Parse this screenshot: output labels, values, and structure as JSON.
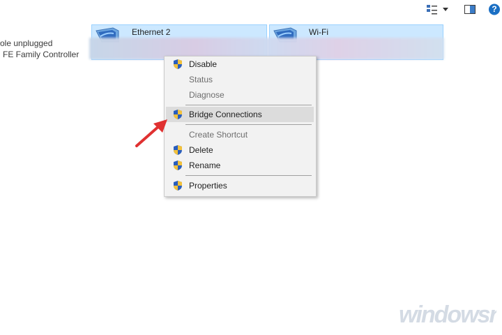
{
  "toolbar": {
    "view_icon": "view-options-icon",
    "dropdown_icon": "chevron-down-icon",
    "preview_pane_icon": "preview-pane-icon",
    "help_icon": "help-icon",
    "help_glyph": "?"
  },
  "left_adapter": {
    "status_line": "ole unplugged",
    "device_line": "FE Family Controller"
  },
  "adapters": [
    {
      "name": "Ethernet 2",
      "icon": "network-adapter-icon"
    },
    {
      "name": "Wi-Fi",
      "icon": "network-adapter-icon"
    }
  ],
  "context_menu": {
    "items": [
      {
        "label": "Disable",
        "icon": "uac-shield-icon",
        "disabled": false
      },
      {
        "label": "Status",
        "icon": "",
        "disabled": true
      },
      {
        "label": "Diagnose",
        "icon": "",
        "disabled": true
      },
      {
        "label": "Bridge Connections",
        "icon": "uac-shield-icon",
        "disabled": false,
        "highlighted": true
      },
      {
        "label": "Create Shortcut",
        "icon": "",
        "disabled": true
      },
      {
        "label": "Delete",
        "icon": "uac-shield-icon",
        "disabled": false
      },
      {
        "label": "Rename",
        "icon": "uac-shield-icon",
        "disabled": false
      },
      {
        "label": "Properties",
        "icon": "uac-shield-icon",
        "disabled": false
      }
    ]
  },
  "annotation": {
    "arrow_color": "#e03131"
  },
  "watermark": {
    "text": "windowsreport"
  },
  "colors": {
    "selection": "#cce8ff",
    "selection_border": "#99d1ff",
    "menu_bg": "#f2f2f2",
    "menu_hover": "#dcdcdc",
    "help_blue": "#1a6fc4"
  }
}
